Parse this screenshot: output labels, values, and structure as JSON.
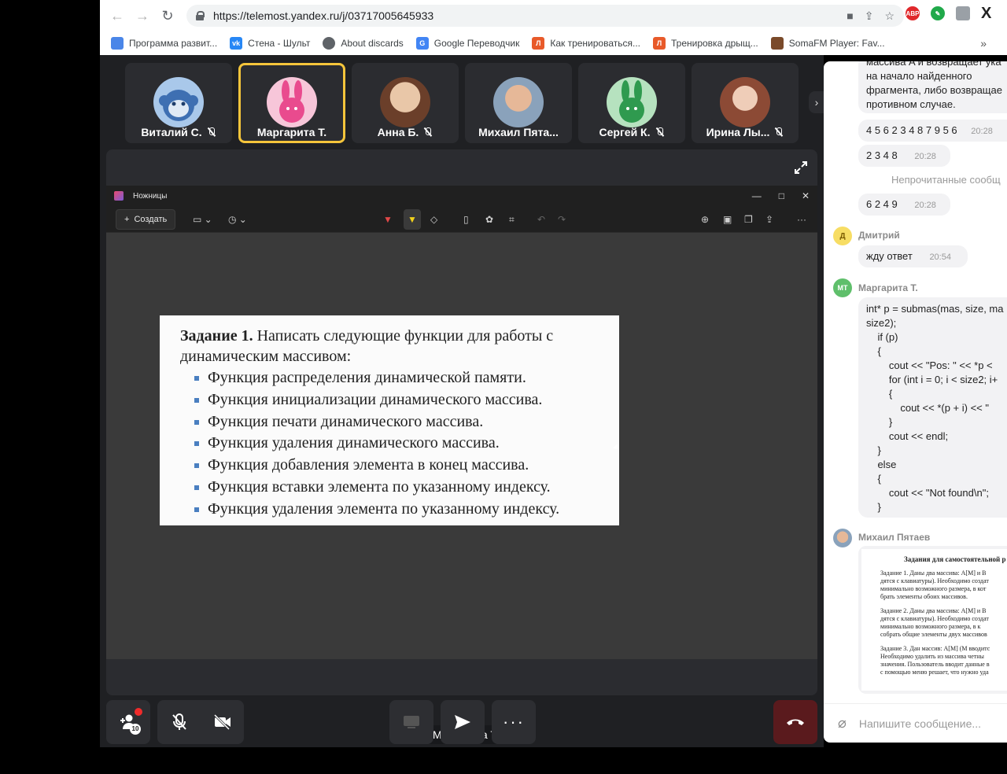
{
  "browser": {
    "url": "https://telemost.yandex.ru/j/03717005645933",
    "bookmarks": [
      {
        "label": "Программа развит...",
        "color": "#4a86e8",
        "icon": "leaf-icon"
      },
      {
        "label": "Стена - Шульт",
        "color": "#2787f5",
        "icon": "vk-icon"
      },
      {
        "label": "About discards",
        "color": "#3c4043",
        "icon": "globe-icon"
      },
      {
        "label": "Google Переводчик",
        "color": "#4285f4",
        "icon": "translate-icon"
      },
      {
        "label": "Как тренироваться...",
        "color": "#e85a2a",
        "icon": "l-icon"
      },
      {
        "label": "Тренировка дрыщ...",
        "color": "#e85a2a",
        "icon": "l-icon"
      },
      {
        "label": "SomaFM Player: Fav...",
        "color": "#7a4a2a",
        "icon": "soma-icon"
      }
    ],
    "ext_abp": "ABP"
  },
  "participants": [
    {
      "name": "Виталий С.",
      "muted": true,
      "avatar": "monkey-icon",
      "color": "#a9c8ea",
      "active": false
    },
    {
      "name": "Маргарита Т.",
      "muted": false,
      "avatar": "bunny-icon",
      "color": "#f7c6d9",
      "active": true
    },
    {
      "name": "Анна Б.",
      "muted": true,
      "avatar": "photo",
      "color": "#c48a5a",
      "active": false
    },
    {
      "name": "Михаил Пята...",
      "muted": false,
      "avatar": "photo",
      "color": "#9fb3c8",
      "active": false
    },
    {
      "name": "Сергей К.",
      "muted": true,
      "avatar": "bunny-icon",
      "color": "#b6e2bf",
      "active": false
    },
    {
      "name": "Ирина Лы...",
      "muted": true,
      "avatar": "photo",
      "color": "#a8674f",
      "active": false
    }
  ],
  "more_label": "›",
  "snip": {
    "title": "Ножницы",
    "create": "Создать"
  },
  "slide": {
    "task_bold": "Задание 1.",
    "task_rest": " Написать следующие функции для работы с динамическим массивом:",
    "items": [
      "Функция распределения динамической памяти.",
      "Функция инициализации динамического массива.",
      "Функция печати динамического массива.",
      "Функция удаления динамического массива.",
      "Функция добавления элемента в конец массива.",
      "Функция вставки элемента по указанному индексу.",
      "Функция удаления элемента по указанному индексу."
    ]
  },
  "speaker": "Маргарита Т.",
  "controls": {
    "participants_count": "10"
  },
  "chat": {
    "top_text_lines": [
      "массива A и возвращает ука",
      "на начало найденного",
      "фрагмента, либо возвращае",
      "противном случае."
    ],
    "msg1": {
      "text": "4 5 6 2 3 4 8 7 9 5 6",
      "time": "20:28"
    },
    "msg2": {
      "text": "2 3 4 8",
      "time": "20:28"
    },
    "unread": "Непрочитанные сообщ",
    "msg3": {
      "text": "6 2 4 9",
      "time": "20:28"
    },
    "sender1": {
      "name": "Дмитрий",
      "initials": "Д"
    },
    "msg4": {
      "text": "жду ответ",
      "time": "20:54"
    },
    "sender2": {
      "name": "Маргарита Т.",
      "initials": "МТ"
    },
    "code": "int* p = submas(mas, size, ma\nsize2);\n    if (p)\n    {\n        cout << \"Pos: \" << *p <\n        for (int i = 0; i < size2; i+\n        {\n            cout << *(p + i) << \"\n        }\n        cout << endl;\n    }\n    else\n    {\n        cout << \"Not found\\n\";\n    }",
    "sender3": {
      "name": "Михаил Пятаев"
    },
    "doc": {
      "heading": "Задания для самостоятельной р",
      "p1": [
        "Задание 1. Даны два массива: A[M] и B",
        "дятся с клавиатуры). Необходимо создат",
        "минимально возможного размера, в кот",
        "брать элементы обоих массивов."
      ],
      "p2": [
        "Задание 2. Даны два массива: A[M] и B",
        "дятся с клавиатуры). Необходимо создат",
        "минимально возможного размера, в к",
        "собрать общие элементы двух массивов"
      ],
      "p3": [
        "Задание 3. Дан массив: A[M] (M вводитс",
        "Необходимо удалить из массива четны",
        "значения. Пользователь вводит данные в",
        "с помощью меню решает, что нужно уда"
      ]
    },
    "input_placeholder": "Напишите сообщение..."
  }
}
